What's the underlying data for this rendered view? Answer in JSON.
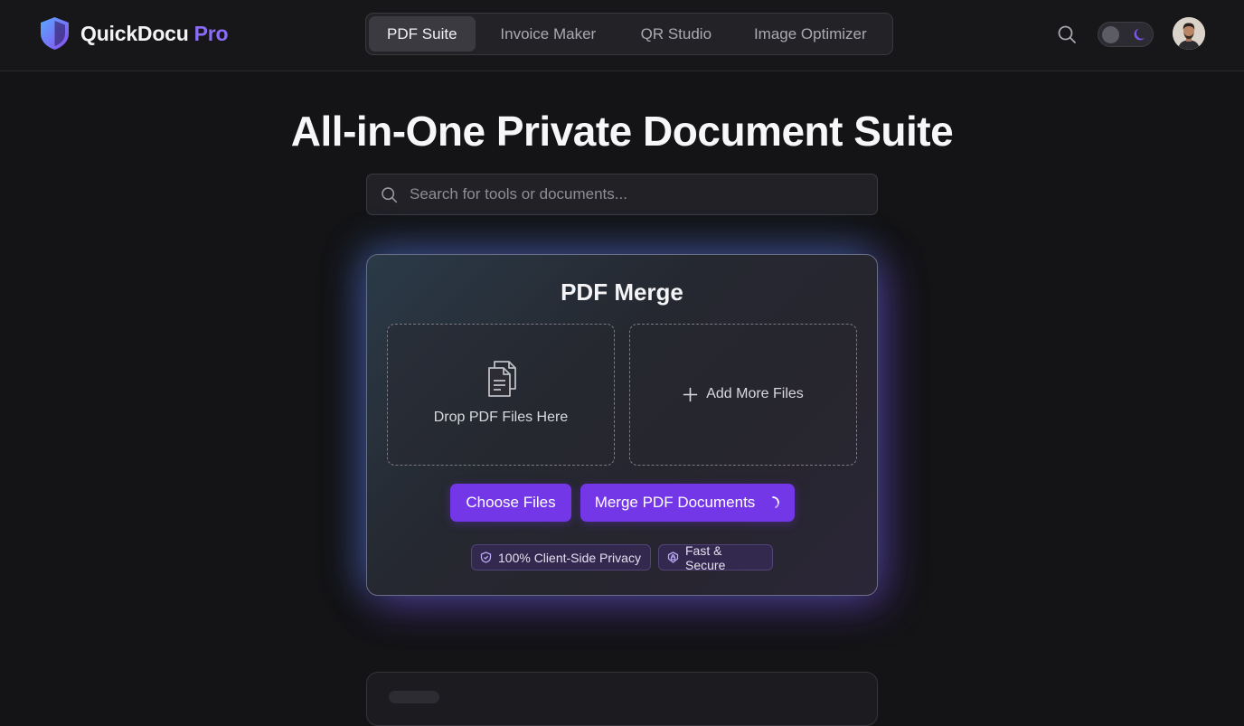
{
  "brand": {
    "name": "QuickDocu",
    "accent": "Pro",
    "logo_icon": "shield-logo-icon"
  },
  "nav": {
    "tabs": [
      {
        "label": "PDF Suite",
        "active": true
      },
      {
        "label": "Invoice Maker",
        "active": false
      },
      {
        "label": "QR Studio",
        "active": false
      },
      {
        "label": "Image Optimizer",
        "active": false
      }
    ]
  },
  "header_actions": {
    "search_icon": "search-icon",
    "theme": "dark",
    "theme_icon": "moon-icon",
    "avatar_icon": "avatar"
  },
  "hero": {
    "title": "All-in-One Private Document Suite"
  },
  "search": {
    "placeholder": "Search for tools or documents..."
  },
  "card": {
    "title": "PDF Merge",
    "dropzone_label": "Drop PDF Files Here",
    "add_more_label": "Add More Files",
    "choose_button": "Choose Files",
    "merge_button": "Merge PDF Documents",
    "badges": [
      {
        "label": "100% Client-Side Privacy",
        "icon": "shield-icon"
      },
      {
        "label": "Fast & Secure",
        "icon": "lock-shield-icon"
      }
    ]
  },
  "colors": {
    "accent": "#7337e8",
    "brand_accent": "#8b6cf6",
    "background": "#141416"
  }
}
